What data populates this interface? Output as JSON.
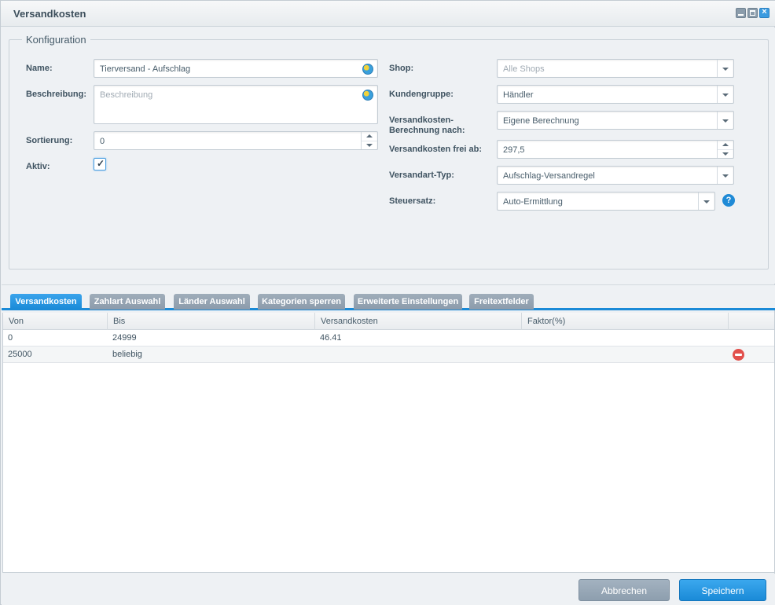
{
  "window": {
    "title": "Versandkosten"
  },
  "config": {
    "legend": "Konfiguration",
    "name": {
      "label": "Name:",
      "value": "Tierversand - Aufschlag"
    },
    "beschreibung": {
      "label": "Beschreibung:",
      "placeholder": "Beschreibung"
    },
    "sortierung": {
      "label": "Sortierung:",
      "value": "0"
    },
    "aktiv": {
      "label": "Aktiv:",
      "checked": true,
      "tick": "✓"
    },
    "shop": {
      "label": "Shop:",
      "placeholder": "Alle Shops"
    },
    "kundengruppe": {
      "label": "Kundengruppe:",
      "value": "Händler"
    },
    "berechnung": {
      "label_line1": "Versandkosten-",
      "label_line2": "Berechnung nach:",
      "value": "Eigene Berechnung"
    },
    "frei_ab": {
      "label": "Versandkosten frei ab:",
      "value": "297,5"
    },
    "versandart_typ": {
      "label": "Versandart-Typ:",
      "value": "Aufschlag-Versandregel"
    },
    "steuersatz": {
      "label": "Steuersatz:",
      "value": "Auto-Ermittlung",
      "help": "?"
    }
  },
  "tabs": [
    {
      "label": "Versandkosten",
      "active": true
    },
    {
      "label": "Zahlart Auswahl",
      "active": false
    },
    {
      "label": "Länder Auswahl",
      "active": false
    },
    {
      "label": "Kategorien sperren",
      "active": false
    },
    {
      "label": "Erweiterte Einstellungen",
      "active": false
    },
    {
      "label": "Freitextfelder",
      "active": false
    }
  ],
  "grid": {
    "columns": [
      "Von",
      "Bis",
      "Versandkosten",
      "Faktor(%)"
    ],
    "rows": [
      {
        "von": "0",
        "bis": "24999",
        "versandkosten": "46.41",
        "faktor": ""
      },
      {
        "von": "25000",
        "bis": "beliebig",
        "versandkosten": "",
        "faktor": ""
      }
    ]
  },
  "footer": {
    "cancel_label": "Abbrechen",
    "save_label": "Speichern"
  },
  "colors": {
    "accent": "#1a8ad7",
    "delete": "#e2504c",
    "tab_inactive": "#8c9bab"
  }
}
